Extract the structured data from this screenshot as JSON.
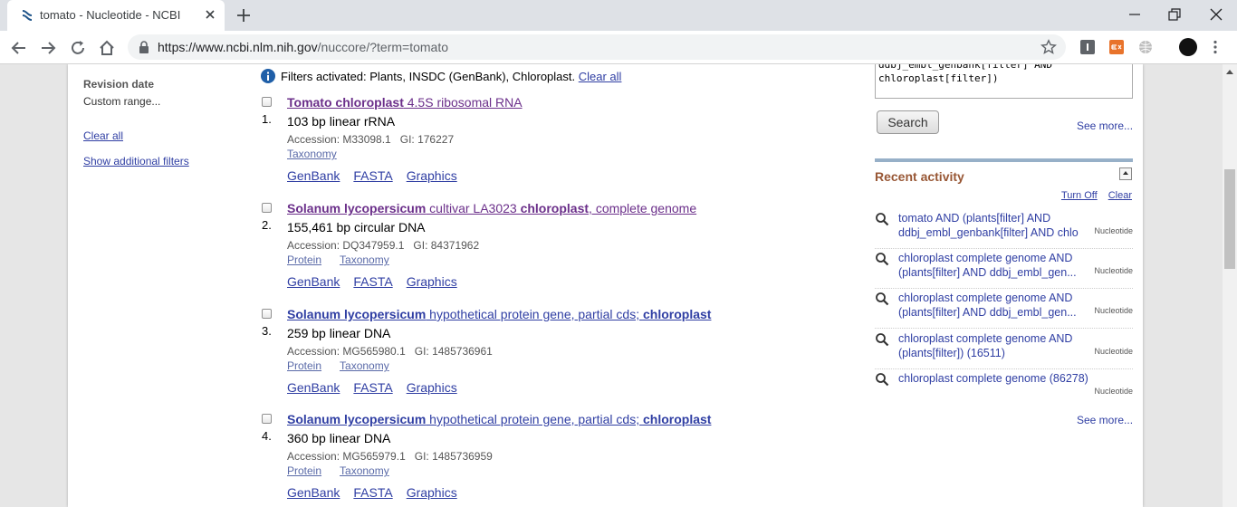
{
  "browser": {
    "tab_title": "tomato - Nucleotide - NCBI",
    "url_host": "https://www.ncbi.nlm.nih.gov",
    "url_path": "/nuccore/?term=tomato",
    "extensions": [
      {
        "name": "ext-i-icon",
        "color": "#5f6368"
      },
      {
        "name": "ext-orange-icon",
        "color": "#e8732b"
      },
      {
        "name": "globe-icon",
        "color": "#bdbdbd"
      }
    ]
  },
  "filters": {
    "revision_date": "Revision date",
    "custom_range": "Custom range...",
    "clear_all": "Clear all",
    "show_additional": "Show additional filters"
  },
  "notice": {
    "text": "Filters activated: Plants, INSDC (GenBank), Chloroplast.",
    "clear_all": "Clear all"
  },
  "results": [
    {
      "num": "1.",
      "title_bold": "Tomato chloroplast",
      "title_rest": " 4.5S ribosomal RNA",
      "desc": "103 bp linear rRNA",
      "accession": "Accession: M33098.1",
      "gi": "GI: 176227",
      "sublinks": [
        "Taxonomy"
      ],
      "actions": [
        "GenBank",
        "FASTA",
        "Graphics"
      ]
    },
    {
      "num": "2.",
      "title_bold": "Solanum lycopersicum",
      "title_mid": " cultivar LA3023 ",
      "title_bold2": "chloroplast",
      "title_rest": ", complete genome",
      "desc": "155,461 bp circular DNA",
      "accession": "Accession: DQ347959.1",
      "gi": "GI: 84371962",
      "sublinks": [
        "Protein",
        "Taxonomy"
      ],
      "actions": [
        "GenBank",
        "FASTA",
        "Graphics"
      ]
    },
    {
      "num": "3.",
      "title_bold": "Solanum lycopersicum",
      "title_mid": " hypothetical protein gene, partial cds; ",
      "title_bold2": "chloroplast",
      "desc": "259 bp linear DNA",
      "accession": "Accession: MG565980.1",
      "gi": "GI: 1485736961",
      "sublinks": [
        "Protein",
        "Taxonomy"
      ],
      "actions": [
        "GenBank",
        "FASTA",
        "Graphics"
      ]
    },
    {
      "num": "4.",
      "title_bold": "Solanum lycopersicum",
      "title_mid": " hypothetical protein gene, partial cds; ",
      "title_bold2": "chloroplast",
      "desc": "360 bp linear DNA",
      "accession": "Accession: MG565979.1",
      "gi": "GI: 1485736959",
      "sublinks": [
        "Protein",
        "Taxonomy"
      ],
      "actions": [
        "GenBank",
        "FASTA",
        "Graphics"
      ]
    }
  ],
  "sidebar": {
    "query_text": "ddbj_embl_genbank[filter] AND\nchloroplast[filter])",
    "search_button": "Search",
    "see_more_1": "See more...",
    "recent_title": "Recent activity",
    "turn_off": "Turn Off",
    "clear": "Clear",
    "recent": [
      {
        "text": "tomato AND (plants[filter] AND ddbj_embl_genbank[filter] AND chlo",
        "db": "Nucleotide"
      },
      {
        "text": "chloroplast complete genome AND (plants[filter] AND ddbj_embl_gen...",
        "db": "Nucleotide"
      },
      {
        "text": "chloroplast complete genome AND (plants[filter] AND ddbj_embl_gen...",
        "db": "Nucleotide"
      },
      {
        "text": "chloroplast complete genome AND (plants[filter]) (16511)",
        "db": "Nucleotide"
      },
      {
        "text": "chloroplast complete genome (86278)",
        "db": "Nucleotide"
      }
    ],
    "see_more_2": "See more..."
  },
  "colors": {
    "link": "#2f3ea3",
    "visited_title": "#6b2f8a",
    "recent_title": "#985735"
  }
}
